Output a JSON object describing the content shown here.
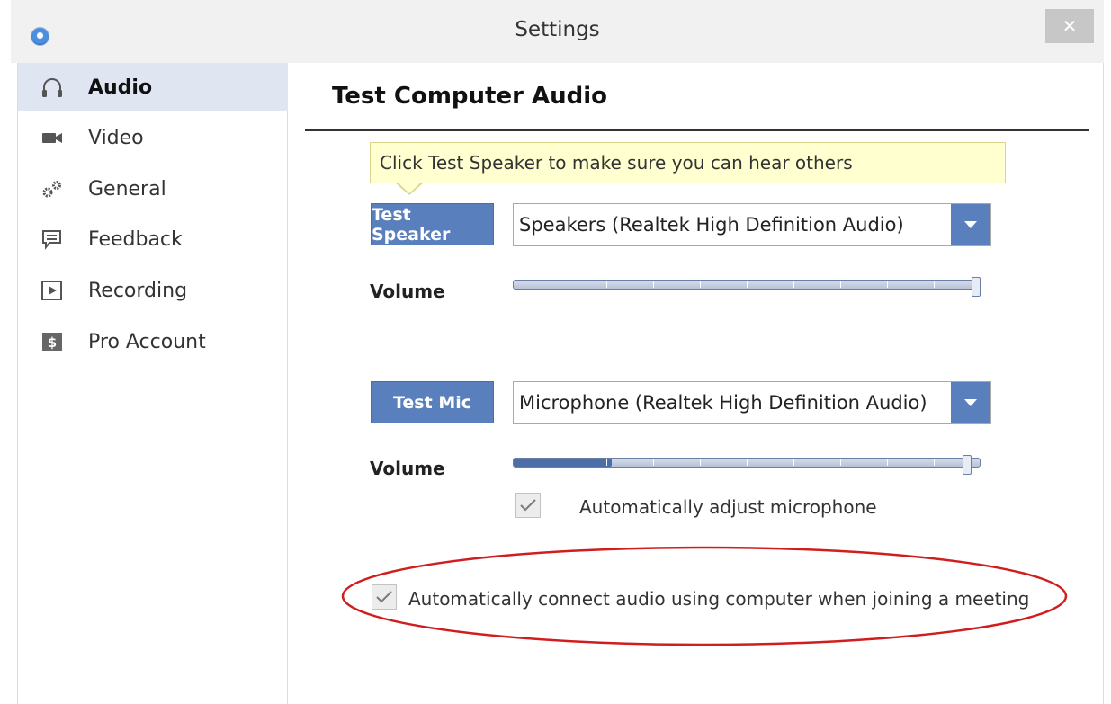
{
  "window": {
    "title": "Settings",
    "close_label": "✕"
  },
  "sidebar": {
    "items": [
      {
        "label": "Audio",
        "icon": "headphones-icon",
        "active": true
      },
      {
        "label": "Video",
        "icon": "video-camera-icon",
        "active": false
      },
      {
        "label": "General",
        "icon": "gears-icon",
        "active": false
      },
      {
        "label": "Feedback",
        "icon": "speech-bubble-icon",
        "active": false
      },
      {
        "label": "Recording",
        "icon": "play-box-icon",
        "active": false
      },
      {
        "label": "Pro Account",
        "icon": "dollar-card-icon",
        "active": false
      }
    ]
  },
  "main": {
    "title": "Test Computer Audio",
    "tooltip": "Click Test Speaker to make sure you can hear others",
    "speaker": {
      "button": "Test Speaker",
      "device": "Speakers (Realtek High Definition Audio)",
      "volume_label": "Volume",
      "volume_level": 1.0
    },
    "mic": {
      "button": "Test Mic",
      "device": "Microphone (Realtek High Definition Audio)",
      "volume_label": "Volume",
      "volume_level": 0.98,
      "input_level": 0.21
    },
    "auto_adjust": {
      "label": "Automatically adjust microphone",
      "checked": true
    },
    "auto_connect": {
      "label": "Automatically connect audio using computer when joining a meeting",
      "checked": true
    }
  },
  "colors": {
    "accent": "#5a7fbd",
    "sidebar_active": "#dfe5f1",
    "tooltip_bg": "#ffffcf",
    "annotation": "#d01e1e"
  }
}
